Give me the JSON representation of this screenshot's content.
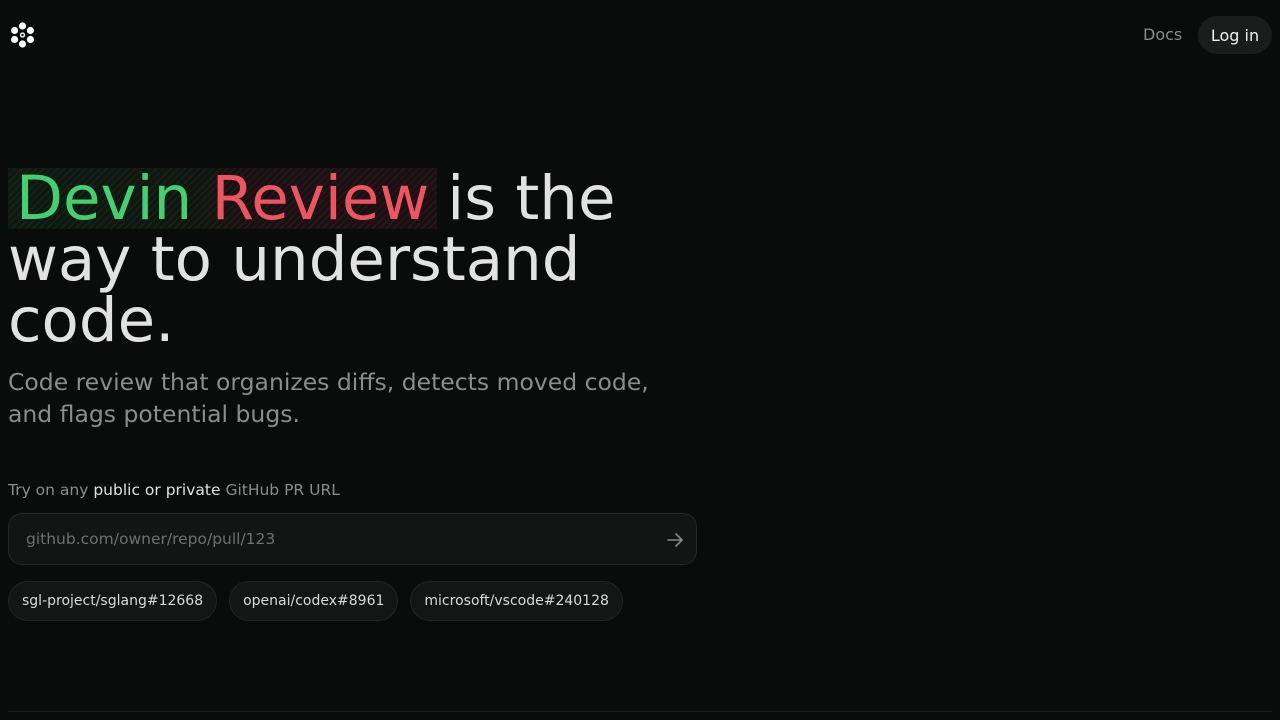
{
  "header": {
    "logo_icon": "devin-logo-icon",
    "docs_label": "Docs",
    "login_label": "Log in"
  },
  "hero": {
    "highlight_word_1": "Devin",
    "highlight_word_2": "Review",
    "rest_line_1": "is the",
    "rest_line_2": "way to understand",
    "rest_line_3": "code.",
    "highlight_colors": {
      "devin": "#42d16e",
      "review": "#ef5560"
    }
  },
  "subtitle": "Code review that organizes diffs, detects moved code, and flags potential bugs.",
  "try": {
    "prefix": "Try on any",
    "emphasis": "public or private",
    "suffix": "GitHub PR URL"
  },
  "url_input": {
    "placeholder": "github.com/owner/repo/pull/123",
    "value": "",
    "submit_icon": "arrow-right-icon"
  },
  "examples": [
    {
      "label": "sgl-project/sglang#12668"
    },
    {
      "label": "openai/codex#8961"
    },
    {
      "label": "microsoft/vscode#240128"
    }
  ]
}
